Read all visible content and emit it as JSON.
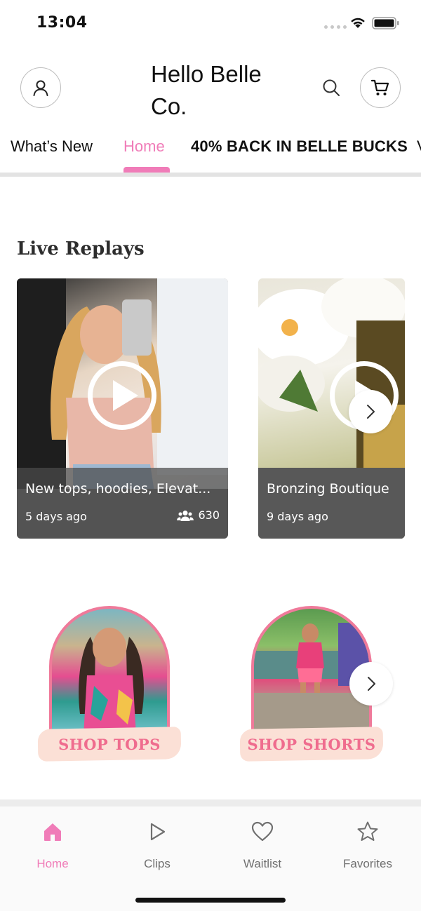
{
  "status_bar": {
    "time": "13:04"
  },
  "header": {
    "title": "Hello Belle Co."
  },
  "tabs": [
    {
      "label": "What’s New"
    },
    {
      "label": "Home"
    },
    {
      "label": "40% BACK IN BELLE BUCKS"
    },
    {
      "label": "V"
    }
  ],
  "live_replays": {
    "title": "Live Replays",
    "items": [
      {
        "title": "New tops, hoodies, Elevat...",
        "time_ago": "5 days ago",
        "viewers": "630"
      },
      {
        "title": "Bronzing Boutique",
        "time_ago": "9 days ago"
      }
    ]
  },
  "shop_tiles": [
    {
      "label": "SHOP TOPS"
    },
    {
      "label": "SHOP SHORTS"
    }
  ],
  "bottom_nav": [
    {
      "label": "Home"
    },
    {
      "label": "Clips"
    },
    {
      "label": "Waitlist"
    },
    {
      "label": "Favorites"
    }
  ],
  "colors": {
    "accent": "#f07cb8",
    "shop_label": "#ef6c8e",
    "arch_border": "#ef7a9a"
  },
  "icons": [
    "account-icon",
    "search-icon",
    "cart-icon",
    "play-icon",
    "chevron-right-icon",
    "people-icon",
    "home-icon",
    "clips-icon",
    "heart-icon",
    "star-icon"
  ]
}
